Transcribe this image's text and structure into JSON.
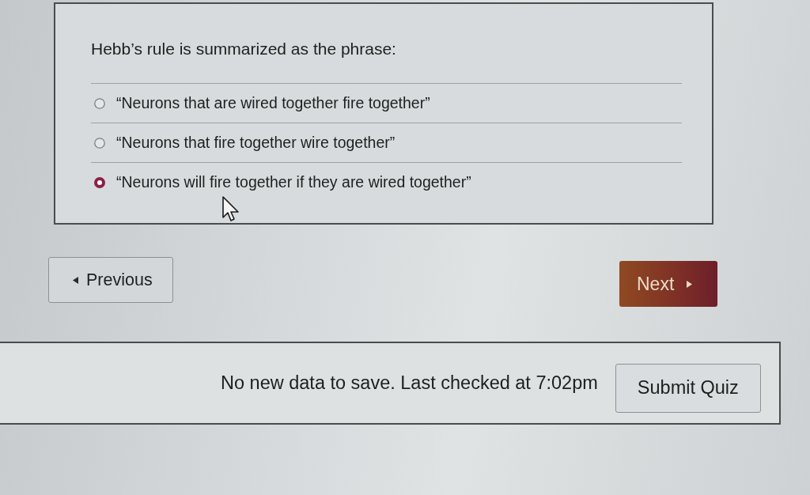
{
  "question": {
    "text": "Hebb’s rule is summarized as the phrase:",
    "options": [
      {
        "label": "“Neurons that are wired together fire together”",
        "selected": false
      },
      {
        "label": "“Neurons that fire together wire together”",
        "selected": false
      },
      {
        "label": "“Neurons will fire together if they are wired together”",
        "selected": true
      }
    ]
  },
  "navigation": {
    "previous": "Previous",
    "next": "Next"
  },
  "footer": {
    "status": "No new data to save. Last checked at 7:02pm",
    "submit": "Submit Quiz"
  }
}
